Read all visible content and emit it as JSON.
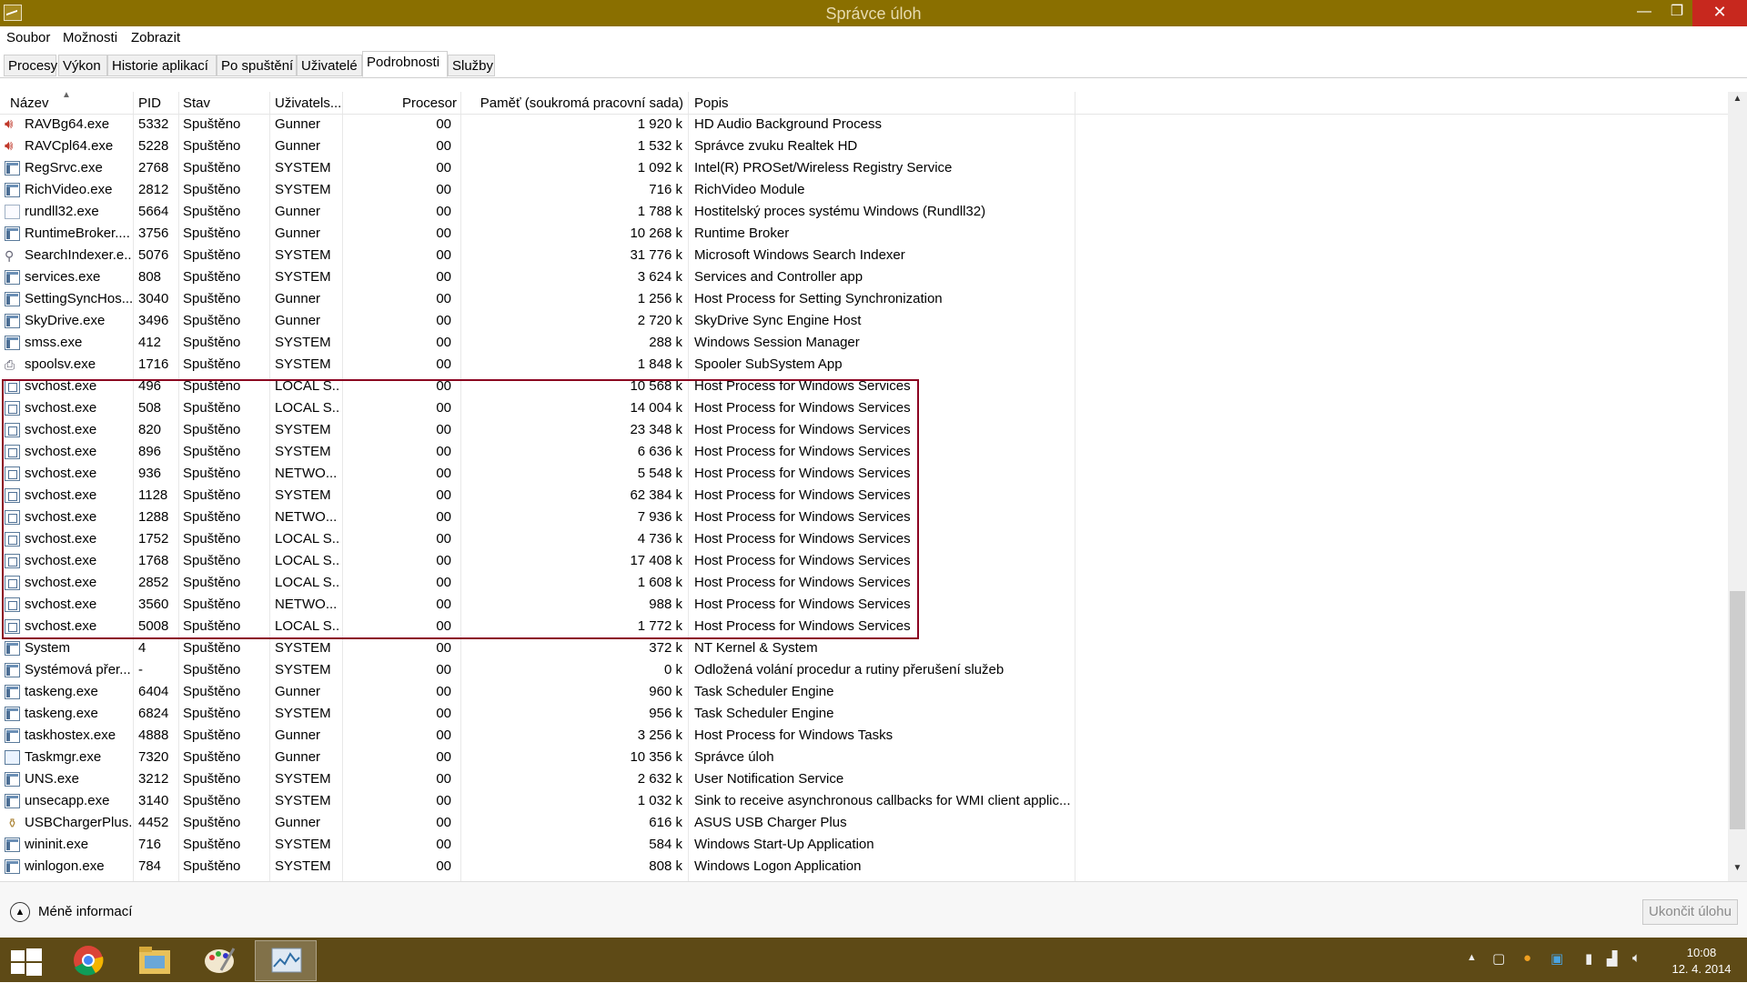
{
  "window": {
    "title": "Správce úloh",
    "minimize_label": "—",
    "maximize_label": "❐",
    "close_label": "✕"
  },
  "menu": [
    {
      "label": "Soubor"
    },
    {
      "label": "Možnosti"
    },
    {
      "label": "Zobrazit"
    }
  ],
  "tabs": [
    {
      "label": "Procesy"
    },
    {
      "label": "Výkon"
    },
    {
      "label": "Historie aplikací"
    },
    {
      "label": "Po spuštění"
    },
    {
      "label": "Uživatelé"
    },
    {
      "label": "Podrobnosti",
      "active": true
    },
    {
      "label": "Služby"
    }
  ],
  "columns": {
    "name": "Název",
    "pid": "PID",
    "state": "Stav",
    "user": "Uživatels...",
    "cpu": "Procesor",
    "memory": "Paměť (soukromá pracovní sada)",
    "desc": "Popis"
  },
  "processes": [
    {
      "icon": "speaker-icon",
      "name": "RAVBg64.exe",
      "pid": "5332",
      "state": "Spuštěno",
      "user": "Gunner",
      "cpu": "00",
      "mem": "1 920 k",
      "desc": "HD Audio Background Process"
    },
    {
      "icon": "speaker-icon",
      "name": "RAVCpl64.exe",
      "pid": "5228",
      "state": "Spuštěno",
      "user": "Gunner",
      "cpu": "00",
      "mem": "1 532 k",
      "desc": "Správce zvuku Realtek HD"
    },
    {
      "icon": "exe-icon",
      "name": "RegSrvc.exe",
      "pid": "2768",
      "state": "Spuštěno",
      "user": "SYSTEM",
      "cpu": "00",
      "mem": "1 092 k",
      "desc": "Intel(R) PROSet/Wireless Registry Service"
    },
    {
      "icon": "exe-icon",
      "name": "RichVideo.exe",
      "pid": "2812",
      "state": "Spuštěno",
      "user": "SYSTEM",
      "cpu": "00",
      "mem": "716 k",
      "desc": "RichVideo Module"
    },
    {
      "icon": "document-icon",
      "name": "rundll32.exe",
      "pid": "5664",
      "state": "Spuštěno",
      "user": "Gunner",
      "cpu": "00",
      "mem": "1 788 k",
      "desc": "Hostitelský proces systému Windows (Rundll32)"
    },
    {
      "icon": "exe-icon",
      "name": "RuntimeBroker....",
      "pid": "3756",
      "state": "Spuštěno",
      "user": "Gunner",
      "cpu": "00",
      "mem": "10 268 k",
      "desc": "Runtime Broker"
    },
    {
      "icon": "search-icon",
      "name": "SearchIndexer.e...",
      "pid": "5076",
      "state": "Spuštěno",
      "user": "SYSTEM",
      "cpu": "00",
      "mem": "31 776 k",
      "desc": "Microsoft Windows Search Indexer"
    },
    {
      "icon": "exe-icon",
      "name": "services.exe",
      "pid": "808",
      "state": "Spuštěno",
      "user": "SYSTEM",
      "cpu": "00",
      "mem": "3 624 k",
      "desc": "Services and Controller app"
    },
    {
      "icon": "exe-icon",
      "name": "SettingSyncHos...",
      "pid": "3040",
      "state": "Spuštěno",
      "user": "Gunner",
      "cpu": "00",
      "mem": "1 256 k",
      "desc": "Host Process for Setting Synchronization"
    },
    {
      "icon": "exe-icon",
      "name": "SkyDrive.exe",
      "pid": "3496",
      "state": "Spuštěno",
      "user": "Gunner",
      "cpu": "00",
      "mem": "2 720 k",
      "desc": "SkyDrive Sync Engine Host"
    },
    {
      "icon": "exe-icon",
      "name": "smss.exe",
      "pid": "412",
      "state": "Spuštěno",
      "user": "SYSTEM",
      "cpu": "00",
      "mem": "288 k",
      "desc": "Windows Session Manager"
    },
    {
      "icon": "printer-icon",
      "name": "spoolsv.exe",
      "pid": "1716",
      "state": "Spuštěno",
      "user": "SYSTEM",
      "cpu": "00",
      "mem": "1 848 k",
      "desc": "Spooler SubSystem App"
    },
    {
      "icon": "service-icon",
      "name": "svchost.exe",
      "pid": "496",
      "state": "Spuštěno",
      "user": "LOCAL S...",
      "cpu": "00",
      "mem": "10 568 k",
      "desc": "Host Process for Windows Services"
    },
    {
      "icon": "service-icon",
      "name": "svchost.exe",
      "pid": "508",
      "state": "Spuštěno",
      "user": "LOCAL S...",
      "cpu": "00",
      "mem": "14 004 k",
      "desc": "Host Process for Windows Services"
    },
    {
      "icon": "service-icon",
      "name": "svchost.exe",
      "pid": "820",
      "state": "Spuštěno",
      "user": "SYSTEM",
      "cpu": "00",
      "mem": "23 348 k",
      "desc": "Host Process for Windows Services"
    },
    {
      "icon": "service-icon",
      "name": "svchost.exe",
      "pid": "896",
      "state": "Spuštěno",
      "user": "SYSTEM",
      "cpu": "00",
      "mem": "6 636 k",
      "desc": "Host Process for Windows Services"
    },
    {
      "icon": "service-icon",
      "name": "svchost.exe",
      "pid": "936",
      "state": "Spuštěno",
      "user": "NETWO...",
      "cpu": "00",
      "mem": "5 548 k",
      "desc": "Host Process for Windows Services"
    },
    {
      "icon": "service-icon",
      "name": "svchost.exe",
      "pid": "1128",
      "state": "Spuštěno",
      "user": "SYSTEM",
      "cpu": "00",
      "mem": "62 384 k",
      "desc": "Host Process for Windows Services"
    },
    {
      "icon": "service-icon",
      "name": "svchost.exe",
      "pid": "1288",
      "state": "Spuštěno",
      "user": "NETWO...",
      "cpu": "00",
      "mem": "7 936 k",
      "desc": "Host Process for Windows Services"
    },
    {
      "icon": "service-icon",
      "name": "svchost.exe",
      "pid": "1752",
      "state": "Spuštěno",
      "user": "LOCAL S...",
      "cpu": "00",
      "mem": "4 736 k",
      "desc": "Host Process for Windows Services"
    },
    {
      "icon": "service-icon",
      "name": "svchost.exe",
      "pid": "1768",
      "state": "Spuštěno",
      "user": "LOCAL S...",
      "cpu": "00",
      "mem": "17 408 k",
      "desc": "Host Process for Windows Services"
    },
    {
      "icon": "service-icon",
      "name": "svchost.exe",
      "pid": "2852",
      "state": "Spuštěno",
      "user": "LOCAL S...",
      "cpu": "00",
      "mem": "1 608 k",
      "desc": "Host Process for Windows Services"
    },
    {
      "icon": "service-icon",
      "name": "svchost.exe",
      "pid": "3560",
      "state": "Spuštěno",
      "user": "NETWO...",
      "cpu": "00",
      "mem": "988 k",
      "desc": "Host Process for Windows Services"
    },
    {
      "icon": "service-icon",
      "name": "svchost.exe",
      "pid": "5008",
      "state": "Spuštěno",
      "user": "LOCAL S...",
      "cpu": "00",
      "mem": "1 772 k",
      "desc": "Host Process for Windows Services"
    },
    {
      "icon": "exe-icon",
      "name": "System",
      "pid": "4",
      "state": "Spuštěno",
      "user": "SYSTEM",
      "cpu": "00",
      "mem": "372 k",
      "desc": "NT Kernel & System"
    },
    {
      "icon": "exe-icon",
      "name": "Systémová přer...",
      "pid": "-",
      "state": "Spuštěno",
      "user": "SYSTEM",
      "cpu": "00",
      "mem": "0 k",
      "desc": "Odložená volání procedur a rutiny přerušení služeb"
    },
    {
      "icon": "exe-icon",
      "name": "taskeng.exe",
      "pid": "6404",
      "state": "Spuštěno",
      "user": "Gunner",
      "cpu": "00",
      "mem": "960 k",
      "desc": "Task Scheduler Engine"
    },
    {
      "icon": "exe-icon",
      "name": "taskeng.exe",
      "pid": "6824",
      "state": "Spuštěno",
      "user": "SYSTEM",
      "cpu": "00",
      "mem": "956 k",
      "desc": "Task Scheduler Engine"
    },
    {
      "icon": "exe-icon",
      "name": "taskhostex.exe",
      "pid": "4888",
      "state": "Spuštěno",
      "user": "Gunner",
      "cpu": "00",
      "mem": "3 256 k",
      "desc": "Host Process for Windows Tasks"
    },
    {
      "icon": "taskmgr-icon",
      "name": "Taskmgr.exe",
      "pid": "7320",
      "state": "Spuštěno",
      "user": "Gunner",
      "cpu": "00",
      "mem": "10 356 k",
      "desc": "Správce úloh"
    },
    {
      "icon": "exe-icon",
      "name": "UNS.exe",
      "pid": "3212",
      "state": "Spuštěno",
      "user": "SYSTEM",
      "cpu": "00",
      "mem": "2 632 k",
      "desc": "User Notification Service"
    },
    {
      "icon": "exe-icon",
      "name": "unsecapp.exe",
      "pid": "3140",
      "state": "Spuštěno",
      "user": "SYSTEM",
      "cpu": "00",
      "mem": "1 032 k",
      "desc": "Sink to receive asynchronous callbacks for WMI client applic..."
    },
    {
      "icon": "usb-icon",
      "name": "USBChargerPlus...",
      "pid": "4452",
      "state": "Spuštěno",
      "user": "Gunner",
      "cpu": "00",
      "mem": "616 k",
      "desc": "ASUS USB Charger Plus"
    },
    {
      "icon": "exe-icon",
      "name": "wininit.exe",
      "pid": "716",
      "state": "Spuštěno",
      "user": "SYSTEM",
      "cpu": "00",
      "mem": "584 k",
      "desc": "Windows Start-Up Application"
    },
    {
      "icon": "exe-icon",
      "name": "winlogon.exe",
      "pid": "784",
      "state": "Spuštěno",
      "user": "SYSTEM",
      "cpu": "00",
      "mem": "808 k",
      "desc": "Windows Logon Application"
    }
  ],
  "footer": {
    "less_info_label": "Méně informací",
    "end_task_label": "Ukončit úlohu"
  },
  "taskbar": {
    "apps": [
      {
        "name": "chrome-icon",
        "active": false
      },
      {
        "name": "file-explorer-icon",
        "active": false
      },
      {
        "name": "paint-icon",
        "active": false
      },
      {
        "name": "task-manager-icon",
        "active": true
      }
    ],
    "clock_time": "10:08",
    "clock_date": "12. 4. 2014"
  },
  "colors": {
    "titlebar": "#8a6f00",
    "taskbar": "#5e4a16",
    "highlight_border": "#8b0020",
    "close_button": "#c7281e"
  }
}
